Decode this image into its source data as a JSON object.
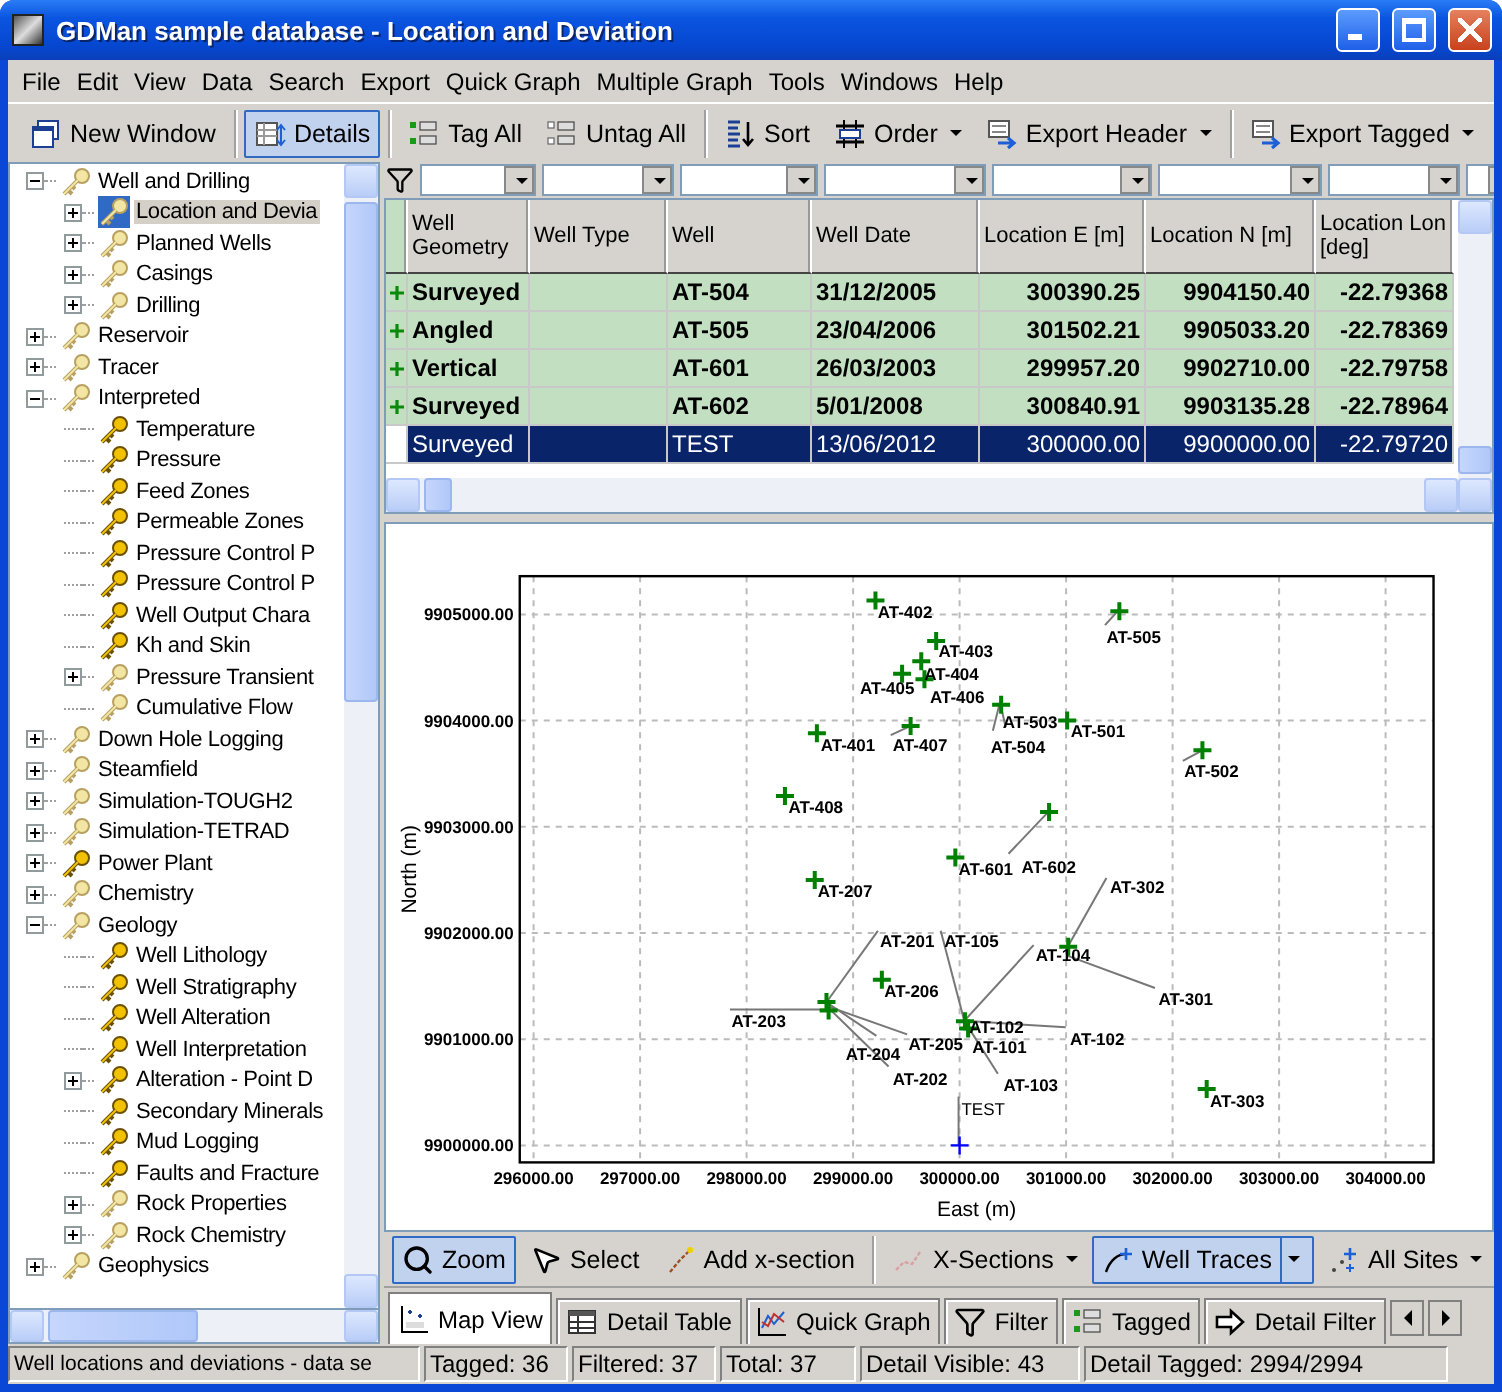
{
  "window": {
    "title": "GDMan sample database - Location and Deviation"
  },
  "menu": [
    "File",
    "Edit",
    "View",
    "Data",
    "Search",
    "Export",
    "Quick Graph",
    "Multiple Graph",
    "Tools",
    "Windows",
    "Help"
  ],
  "toolbar": [
    [
      {
        "label": "New Window",
        "kind": "new-window",
        "pressed": false,
        "dropdown": false
      }
    ],
    [
      {
        "label": "Details",
        "kind": "details",
        "pressed": true,
        "dropdown": false
      }
    ],
    [
      {
        "label": "Tag All",
        "kind": "tag",
        "pressed": false,
        "dropdown": false
      },
      {
        "label": "Untag All",
        "kind": "untag",
        "pressed": false,
        "dropdown": false
      }
    ],
    [
      {
        "label": "Sort",
        "kind": "sort",
        "pressed": false,
        "dropdown": false
      },
      {
        "label": "Order",
        "kind": "order",
        "pressed": false,
        "dropdown": true
      },
      {
        "label": "Export Header",
        "kind": "export",
        "pressed": false,
        "dropdown": true
      }
    ],
    [
      {
        "label": "Export Tagged",
        "kind": "export",
        "pressed": false,
        "dropdown": true
      }
    ]
  ],
  "tree": [
    {
      "label": "Well and Drilling",
      "expanded": true,
      "selected": false,
      "faded": true,
      "children": [
        {
          "label": "Location and Devia",
          "expanded": false,
          "selected": true,
          "faded": true
        },
        {
          "label": "Planned Wells",
          "expanded": false,
          "selected": false,
          "faded": true
        },
        {
          "label": "Casings",
          "expanded": false,
          "selected": false,
          "faded": true
        },
        {
          "label": "Drilling",
          "expanded": false,
          "selected": false,
          "faded": true
        }
      ]
    },
    {
      "label": "Reservoir",
      "expanded": false,
      "selected": false,
      "faded": true
    },
    {
      "label": "Tracer",
      "expanded": false,
      "selected": false,
      "faded": true
    },
    {
      "label": "Interpreted",
      "expanded": true,
      "selected": false,
      "faded": true,
      "children": [
        {
          "label": "Temperature",
          "selected": false,
          "faded": false
        },
        {
          "label": "Pressure",
          "selected": false,
          "faded": false
        },
        {
          "label": "Feed Zones",
          "selected": false,
          "faded": false
        },
        {
          "label": "Permeable Zones",
          "selected": false,
          "faded": false
        },
        {
          "label": "Pressure Control P",
          "selected": false,
          "faded": false
        },
        {
          "label": "Pressure Control P",
          "selected": false,
          "faded": false
        },
        {
          "label": "Well Output Chara",
          "selected": false,
          "faded": false
        },
        {
          "label": "Kh and Skin",
          "selected": false,
          "faded": false
        },
        {
          "label": "Pressure Transient",
          "expanded": false,
          "selected": false,
          "faded": true
        },
        {
          "label": "Cumulative Flow",
          "selected": false,
          "faded": true
        }
      ]
    },
    {
      "label": "Down Hole Logging",
      "expanded": false,
      "selected": false,
      "faded": true
    },
    {
      "label": "Steamfield",
      "expanded": false,
      "selected": false,
      "faded": true
    },
    {
      "label": "Simulation-TOUGH2",
      "expanded": false,
      "selected": false,
      "faded": true
    },
    {
      "label": "Simulation-TETRAD",
      "expanded": false,
      "selected": false,
      "faded": true
    },
    {
      "label": "Power Plant",
      "expanded": false,
      "selected": false,
      "faded": false
    },
    {
      "label": "Chemistry",
      "expanded": false,
      "selected": false,
      "faded": true
    },
    {
      "label": "Geology",
      "expanded": true,
      "selected": false,
      "faded": true,
      "children": [
        {
          "label": "Well Lithology",
          "selected": false,
          "faded": false
        },
        {
          "label": "Well Stratigraphy",
          "selected": false,
          "faded": false
        },
        {
          "label": "Well Alteration",
          "selected": false,
          "faded": false
        },
        {
          "label": "Well Interpretation",
          "selected": false,
          "faded": false
        },
        {
          "label": "Alteration - Point D",
          "expanded": false,
          "selected": false,
          "faded": false
        },
        {
          "label": "Secondary Minerals",
          "selected": false,
          "faded": false
        },
        {
          "label": "Mud Logging",
          "selected": false,
          "faded": false
        },
        {
          "label": "Faults and Fracture",
          "selected": false,
          "faded": false
        },
        {
          "label": "Rock Properties",
          "expanded": false,
          "selected": false,
          "faded": true
        },
        {
          "label": "Rock Chemistry",
          "expanded": false,
          "selected": false,
          "faded": true
        }
      ]
    },
    {
      "label": "Geophysics",
      "expanded": false,
      "selected": false,
      "faded": true
    }
  ],
  "table": {
    "columns": [
      "Well Geometry",
      "Well Type",
      "Well",
      "Well Date",
      "Location E [m]",
      "Location N [m]",
      "Location Lon [deg]"
    ],
    "rows": [
      {
        "geometry": "Surveyed",
        "well": "AT-504",
        "date": "31/12/2005",
        "east": "300390.25",
        "north": "9904150.40",
        "lon": "-22.79368",
        "tagged": true,
        "selected": false
      },
      {
        "geometry": "Angled",
        "well": "AT-505",
        "date": "23/04/2006",
        "east": "301502.21",
        "north": "9905033.20",
        "lon": "-22.78369",
        "tagged": true,
        "selected": false
      },
      {
        "geometry": "Vertical",
        "well": "AT-601",
        "date": "26/03/2003",
        "east": "299957.20",
        "north": "9902710.00",
        "lon": "-22.79758",
        "tagged": true,
        "selected": false
      },
      {
        "geometry": "Surveyed",
        "well": "AT-602",
        "date": "5/01/2008",
        "east": "300840.91",
        "north": "9903135.28",
        "lon": "-22.78964",
        "tagged": true,
        "selected": false
      },
      {
        "geometry": "Surveyed",
        "well": "TEST",
        "date": "13/06/2012",
        "east": "300000.00",
        "north": "9900000.00",
        "lon": "-22.79720",
        "tagged": false,
        "selected": true
      }
    ]
  },
  "plot": {
    "chart_data": {
      "type": "scatter",
      "xlabel": "East (m)",
      "ylabel": "North (m)",
      "grid": true,
      "xlim": [
        295870,
        304450
      ],
      "ylim": [
        9899840,
        9905360
      ],
      "xticks": [
        {
          "value": 296000,
          "label": "296000.00"
        },
        {
          "value": 297000,
          "label": "297000.00"
        },
        {
          "value": 298000,
          "label": "298000.00"
        },
        {
          "value": 299000,
          "label": "299000.00"
        },
        {
          "value": 300000,
          "label": "300000.00"
        },
        {
          "value": 301000,
          "label": "301000.00"
        },
        {
          "value": 302000,
          "label": "302000.00"
        },
        {
          "value": 303000,
          "label": "303000.00"
        },
        {
          "value": 304000,
          "label": "304000.00"
        }
      ],
      "yticks": [
        {
          "value": 9900000,
          "label": "9900000.00"
        },
        {
          "value": 9901000,
          "label": "9901000.00"
        },
        {
          "value": 9902000,
          "label": "9902000.00"
        },
        {
          "value": 9903000,
          "label": "9903000.00"
        },
        {
          "value": 9904000,
          "label": "9904000.00"
        },
        {
          "value": 9905000,
          "label": "9905000.00"
        }
      ],
      "x": [
        299210,
        299780,
        299640,
        299460,
        299670,
        300390,
        301500,
        301010,
        298660,
        299540,
        302280,
        298360,
        300840,
        299960,
        298640,
        301020,
        299270,
        298750,
        298770,
        300050,
        300080,
        302320,
        300000
      ],
      "series": [
        {
          "color": "#008000",
          "values": [
            9905130,
            9904750,
            9904560,
            9904440,
            9904390,
            9904150,
            9905030,
            9904000,
            9903880,
            9903950,
            9903720,
            9903290,
            9903140,
            9902710,
            9902500,
            9901870,
            9901560,
            9901350,
            9901270,
            9901170,
            9901100,
            9900530,
            null
          ]
        },
        {
          "color": "#0000ff",
          "values": [
            null,
            null,
            null,
            null,
            null,
            null,
            null,
            null,
            null,
            null,
            null,
            null,
            null,
            null,
            null,
            null,
            null,
            null,
            null,
            null,
            null,
            null,
            9900000
          ]
        }
      ],
      "annotations": [
        "AT-402",
        "AT-403",
        "AT-404",
        "AT-405",
        "AT-406",
        "AT-504",
        "AT-503",
        "AT-501",
        "AT-505",
        "AT-401",
        "AT-407",
        "AT-502",
        "AT-408",
        "AT-601",
        "AT-602",
        "AT-207",
        "AT-302",
        "AT-201",
        "AT-105",
        "AT-104",
        "AT-206",
        "AT-301",
        "AT-203",
        "AT-102",
        "AT-102",
        "AT-101",
        "AT-204",
        "AT-205",
        "AT-202",
        "AT-103",
        "AT-303",
        "TEST"
      ]
    }
  },
  "map_toolbar": [
    [
      {
        "label": "Zoom",
        "kind": "zoom",
        "pressed": true,
        "dropdown": false,
        "split": false
      },
      {
        "label": "Select",
        "kind": "select",
        "pressed": false,
        "dropdown": false,
        "split": false
      },
      {
        "label": "Add x-section",
        "kind": "add-section",
        "pressed": false,
        "dropdown": false,
        "split": false
      }
    ],
    [
      {
        "label": "X-Sections",
        "kind": "sections",
        "pressed": false,
        "dropdown": true,
        "split": false
      },
      {
        "label": "Well Traces",
        "kind": "traces",
        "pressed": true,
        "dropdown": true,
        "split": true
      },
      {
        "label": "All Sites",
        "kind": "sites",
        "pressed": false,
        "dropdown": true,
        "split": false
      }
    ]
  ],
  "tabs": [
    {
      "label": "Map View",
      "kind": "map",
      "selected": true
    },
    {
      "label": "Detail Table",
      "kind": "table",
      "selected": false
    },
    {
      "label": "Quick Graph",
      "kind": "graph",
      "selected": false
    },
    {
      "label": "Filter",
      "kind": "filter",
      "selected": false
    },
    {
      "label": "Tagged",
      "kind": "tag",
      "selected": false
    },
    {
      "label": "Detail Filter",
      "kind": "detail-filter",
      "selected": false
    }
  ],
  "status_bar": {
    "hint": "Well locations and deviations - data se",
    "panels": [
      "Tagged: 36",
      "Filtered: 37",
      "Total: 37",
      "Detail Visible: 43",
      "Detail Tagged: 2994/2994"
    ]
  }
}
